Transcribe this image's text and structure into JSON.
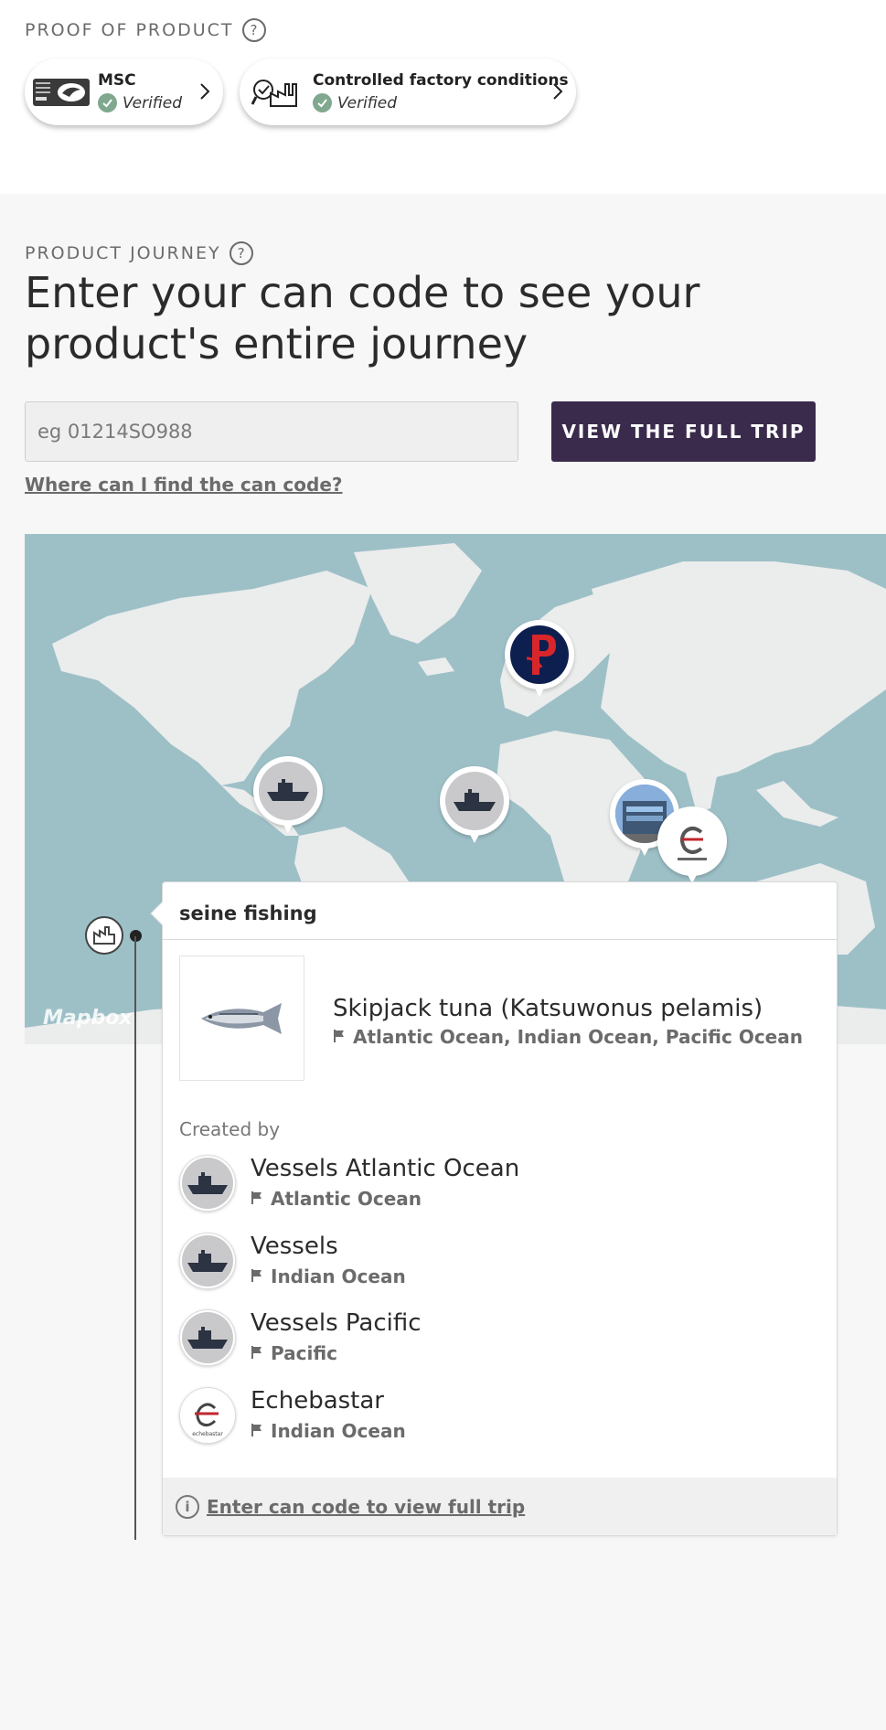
{
  "proof": {
    "label": "PROOF OF PRODUCT",
    "badges": [
      {
        "title": "MSC",
        "status": "Verified",
        "logo_icon": "msc-logo-icon"
      },
      {
        "title": "Controlled factory conditions",
        "status": "Verified",
        "logo_icon": "factory-check-icon"
      }
    ]
  },
  "journey": {
    "label": "PRODUCT JOURNEY",
    "headline": "Enter your can code to see your product's entire journey",
    "input_placeholder": "eg 01214SO988",
    "button_label": "VIEW THE FULL TRIP",
    "find_link": "Where can I find the can code?",
    "map_attribution": "Mapbox",
    "map_pins": [
      {
        "name": "pacific-vessel-pin",
        "icon": "ship-icon"
      },
      {
        "name": "atlantic-vessel-pin",
        "icon": "ship-icon"
      },
      {
        "name": "brand-pin",
        "icon": "brand-p-logo-icon"
      },
      {
        "name": "factory-pin",
        "icon": "factory-photo-icon"
      },
      {
        "name": "echebastar-pin",
        "icon": "echebastar-logo-icon"
      }
    ]
  },
  "timeline": {
    "step_title": "seine fishing",
    "product": {
      "name": "Skipjack tuna (Katsuwonus pelamis)",
      "locations": "Atlantic Ocean, Indian Ocean, Pacific Ocean"
    },
    "created_by_label": "Created by",
    "creators": [
      {
        "name": "Vessels Atlantic Ocean",
        "location": "Atlantic Ocean",
        "icon": "ship-icon"
      },
      {
        "name": "Vessels",
        "location": "Indian Ocean",
        "icon": "ship-icon"
      },
      {
        "name": "Vessels Pacific",
        "location": "Pacific",
        "icon": "ship-icon"
      },
      {
        "name": "Echebastar",
        "location": "Indian Ocean",
        "icon": "echebastar-logo-icon",
        "logo_text": "echebastar"
      }
    ],
    "footer_link": "Enter can code to view full trip"
  },
  "colors": {
    "button_bg": "#3a2b4c",
    "ocean": "#9dc0c7",
    "land": "#ebecec",
    "verified_green": "#7fa88f",
    "brand_navy": "#0d1f4f",
    "brand_red": "#d8262b"
  }
}
